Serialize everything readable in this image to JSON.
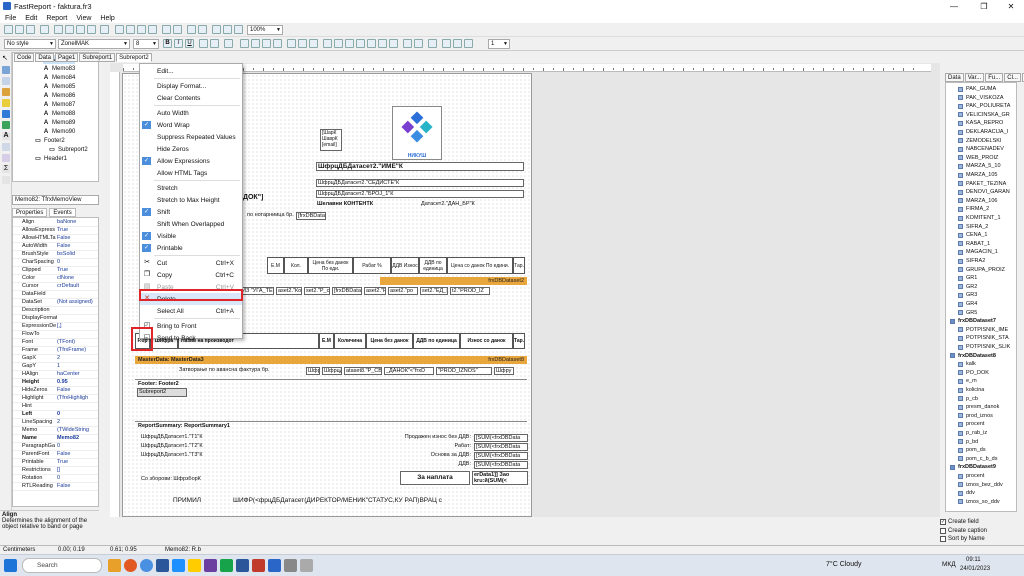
{
  "window": {
    "title": "FastReport - faktura.fr3"
  },
  "menu": [
    "File",
    "Edit",
    "Report",
    "View",
    "Help"
  ],
  "toolbar": {
    "style": "No style",
    "font": "ZonelMAK",
    "size": "8",
    "zoom": "100%",
    "lines": "1"
  },
  "tabs": [
    "Code",
    "Data",
    "Page1",
    "Subreport1",
    "Subreport2"
  ],
  "tree": [
    {
      "label": "Memo82",
      "sel": true
    },
    {
      "label": "Memo83"
    },
    {
      "label": "Memo84"
    },
    {
      "label": "Memo85"
    },
    {
      "label": "Memo86"
    },
    {
      "label": "Memo87"
    },
    {
      "label": "Memo88"
    },
    {
      "label": "Memo89"
    },
    {
      "label": "Memo90"
    },
    {
      "label": "Footer2"
    },
    {
      "label": "Subreport2"
    },
    {
      "label": "Header1"
    }
  ],
  "object_combo": "Memo82: TfrxMemoView",
  "prop_tabs": [
    "Properties",
    "Events"
  ],
  "props": [
    [
      "Align",
      "baNone"
    ],
    [
      "AllowExpress",
      "True"
    ],
    [
      "AllowHTMLTa",
      "False"
    ],
    [
      "AutoWidth",
      "False"
    ],
    [
      "BrushStyle",
      "bsSolid"
    ],
    [
      "CharSpacing",
      "0"
    ],
    [
      "Clipped",
      "True"
    ],
    [
      "Color",
      "clNone"
    ],
    [
      "Cursor",
      "crDefault"
    ],
    [
      "DataField",
      ""
    ],
    [
      "DataSet",
      "(Not assigned)"
    ],
    [
      "Description",
      ""
    ],
    [
      "DisplayFormat",
      ""
    ],
    [
      "ExpressionDe",
      "[,]"
    ],
    [
      "FlowTo",
      ""
    ],
    [
      "Font",
      "(TFont)"
    ],
    [
      "Frame",
      "(TfrxFrame)"
    ],
    [
      "GapX",
      "2"
    ],
    [
      "GapY",
      "1"
    ],
    [
      "HAlign",
      "haCenter"
    ],
    [
      "Height",
      "0.95"
    ],
    [
      "HideZeros",
      "False"
    ],
    [
      "Highlight",
      "(TfrxHighligh"
    ],
    [
      "Hint",
      ""
    ],
    [
      "Left",
      "0"
    ],
    [
      "LineSpacing",
      "2"
    ],
    [
      "Memo",
      "(TWideString"
    ],
    [
      "Name",
      "Memo82"
    ],
    [
      "ParagraphGa",
      "0"
    ],
    [
      "ParentFont",
      "False"
    ],
    [
      "Printable",
      "True"
    ],
    [
      "Restrictions",
      "[]"
    ],
    [
      "Rotation",
      "0"
    ],
    [
      "RTLReading",
      "False"
    ]
  ],
  "prop_desc": {
    "title": "Align",
    "text": "Determines the alignment of the object relative to band or page"
  },
  "status": {
    "units": "Centimeters",
    "pos1": "0.00; 0.19",
    "pos2": "0.61; 0.95",
    "obj": "Memo82: R.b"
  },
  "context_menu": [
    {
      "label": "Edit..."
    },
    {
      "sep": true
    },
    {
      "label": "Display Format..."
    },
    {
      "label": "Clear Contents"
    },
    {
      "sep": true
    },
    {
      "label": "Auto Width"
    },
    {
      "label": "Word Wrap",
      "checked": true
    },
    {
      "label": "Suppress Repeated Values"
    },
    {
      "label": "Hide Zeros"
    },
    {
      "label": "Allow Expressions",
      "checked": true
    },
    {
      "label": "Allow HTML Tags"
    },
    {
      "sep": true
    },
    {
      "label": "Stretch"
    },
    {
      "label": "Stretch to Max Height"
    },
    {
      "label": "Shift",
      "checked": true
    },
    {
      "label": "Shift When Overlapped"
    },
    {
      "label": "Visible",
      "checked": true
    },
    {
      "label": "Printable",
      "checked": true
    },
    {
      "sep": true
    },
    {
      "label": "Cut",
      "sc": "Ctrl+X",
      "icon": "✂"
    },
    {
      "label": "Copy",
      "sc": "Ctrl+C",
      "icon": "❐"
    },
    {
      "label": "Paste",
      "sc": "Ctrl+V",
      "disabled": true,
      "icon": "▤"
    },
    {
      "label": "Delete",
      "icon": "✕"
    },
    {
      "label": "Select All",
      "sc": "Ctrl+A"
    },
    {
      "sep": true
    },
    {
      "label": "Bring to Front",
      "icon": "◰"
    },
    {
      "label": "Send to Back",
      "icon": "◱"
    }
  ],
  "report": {
    "band_titles": {
      "master1": "MasterData: MasterData3",
      "footer2": "Footer: Footer2",
      "summary": "ReportSummary: ReportSummary1",
      "ds8": "frxDBDataset8",
      "ds2": "frxDBDataset2"
    },
    "subreport_label": "Subreport2",
    "header_cols": [
      "Е.М",
      "Кол.",
      "Цена без данок По еди.",
      "Рабат %",
      "ДДВ Износ",
      "ДДВ по единица",
      "Цена со данок По едини.",
      "Тар."
    ],
    "header2_cols": [
      "Р.бр",
      "Шифра",
      "Назив на производот",
      "Е.М",
      "Количина",
      "Цена без данок",
      "ДДВ по единица",
      "Износ со данок",
      "Тар."
    ],
    "company_lines": [
      "ШфрцДБДатасет2.\"ИМЕ\"К",
      "ШфрцДБДатасет2.\"СЕДИСТЕ\"К",
      "ШфрцДБДатасет2.\"БРОЈ_1\"К",
      "Шелавни КОНТЕНТК"
    ],
    "dok_label": "ДОК\"]",
    "napomena": "по нотарниица бр.",
    "datas": "[frxDBDatas",
    "small_memos": [
      "[ШарК",
      "ШаврК",
      "[email]"
    ],
    "row1": [
      "ИЗ \"УГА_ТЕ\"",
      "aset2.\"Кол",
      "set2.\"Р_с",
      "[frxDBDataset2.\"РАБ",
      "aset2.\"Р",
      "aset2.\"ро",
      "set2.\"ЕД_Р",
      "t2.\"PROD_IZ"
    ],
    "row2": [
      "Затворање по авансна фактура бр.",
      "Шфр",
      "ШфрцДБД",
      "ataset8.\"Р_СВ\"",
      "_ДАНОК\"<\"frxD",
      "\"PROD_IZNOS\"",
      "Шфру"
    ],
    "summary_left": [
      "ШфрцДБДатасет1.\"Т1\"К",
      "ШфрцДБДатасет1.\"Т2\"К",
      "ШфрцДБДатасет1.\"Т3\"К"
    ],
    "summary_right_labels": [
      "Продажен износ без ДДВ:",
      "Рабат:",
      "Основа за ДДВ:",
      "ДДВ:"
    ],
    "summary_right_vals": [
      "[SUM(<frxDBData",
      "[SUM(<frxDBData",
      "[SUM(<frxDBData",
      "[SUM(<frxDBData"
    ],
    "za_naplata": "За наплата",
    "za_naplata_val": "erData1]] Зао kru:й(SUM(<",
    "so_zborovi": "Со зборови: ШфрзборК",
    "sign_line": [
      "ПРИМИЛ",
      "ШИФР(<фрцДБДатасет(ДИРЕКТОР/МЕНИК\"СТАТУС,КУ РАП)ВРАЦ со"
    ],
    "logo_text": "НИКУШ",
    "id_memo": "ШфрцДБД",
    "datasets_right": "Датасет2.\"ДАН_БР\"К"
  },
  "data_tabs": [
    "Data",
    "Var...",
    "Fu...",
    "Cl...",
    "..."
  ],
  "data_tree": [
    {
      "l": "PAK_GUMA"
    },
    {
      "l": "PAK_VISKOZA"
    },
    {
      "l": "PAK_POLIURETA"
    },
    {
      "l": "VELICINSKA_GR"
    },
    {
      "l": "KASA_REPRO"
    },
    {
      "l": "DEKLARACIJA_I"
    },
    {
      "l": "ZEMODELSKI"
    },
    {
      "l": "NABCENADEV"
    },
    {
      "l": "WEB_PROIZ"
    },
    {
      "l": "MARZA_5_10"
    },
    {
      "l": "MARZA_105"
    },
    {
      "l": "PAKET_TEZINA"
    },
    {
      "l": "DENOVI_GARAN"
    },
    {
      "l": "MARZA_106"
    },
    {
      "l": "FIRMA_2"
    },
    {
      "l": "KOMITENT_1"
    },
    {
      "l": "SIFRA_2"
    },
    {
      "l": "CENA_1"
    },
    {
      "l": "RABAT_1"
    },
    {
      "l": "MAGACIN_1"
    },
    {
      "l": "SIFRA2"
    },
    {
      "l": "GRUPA_PROIZ"
    },
    {
      "l": "GR1"
    },
    {
      "l": "GR2"
    },
    {
      "l": "GR3"
    },
    {
      "l": "GR4"
    },
    {
      "l": "GR5"
    },
    {
      "l": "frxDBDataset7",
      "ds": true
    },
    {
      "l": "POTPISNIK_IME"
    },
    {
      "l": "POTPISNIK_STA"
    },
    {
      "l": "POTPISNIK_SLIK"
    },
    {
      "l": "frxDBDataset8",
      "ds": true
    },
    {
      "l": "kalk"
    },
    {
      "l": "PO_DOK"
    },
    {
      "l": "e_m"
    },
    {
      "l": "kolicina"
    },
    {
      "l": "p_cb"
    },
    {
      "l": "presm_danok"
    },
    {
      "l": "prod_iznos"
    },
    {
      "l": "procent"
    },
    {
      "l": "p_rab_iz"
    },
    {
      "l": "p_bd"
    },
    {
      "l": "pom_ds"
    },
    {
      "l": "pom_c_b_ds"
    },
    {
      "l": "frxDBDataset9",
      "ds": true
    },
    {
      "l": "procent"
    },
    {
      "l": "iznos_bez_ddv"
    },
    {
      "l": "ddv"
    },
    {
      "l": "iznos_so_ddv"
    }
  ],
  "options": [
    {
      "label": "Create field",
      "checked": true
    },
    {
      "label": "Create caption",
      "checked": false
    },
    {
      "label": "Sort by Name",
      "checked": false
    }
  ],
  "taskbar": {
    "search": "Search",
    "weather": "7°C  Cloudy",
    "lang": "МКД",
    "time": "09:11",
    "date": "24/01/2023"
  }
}
